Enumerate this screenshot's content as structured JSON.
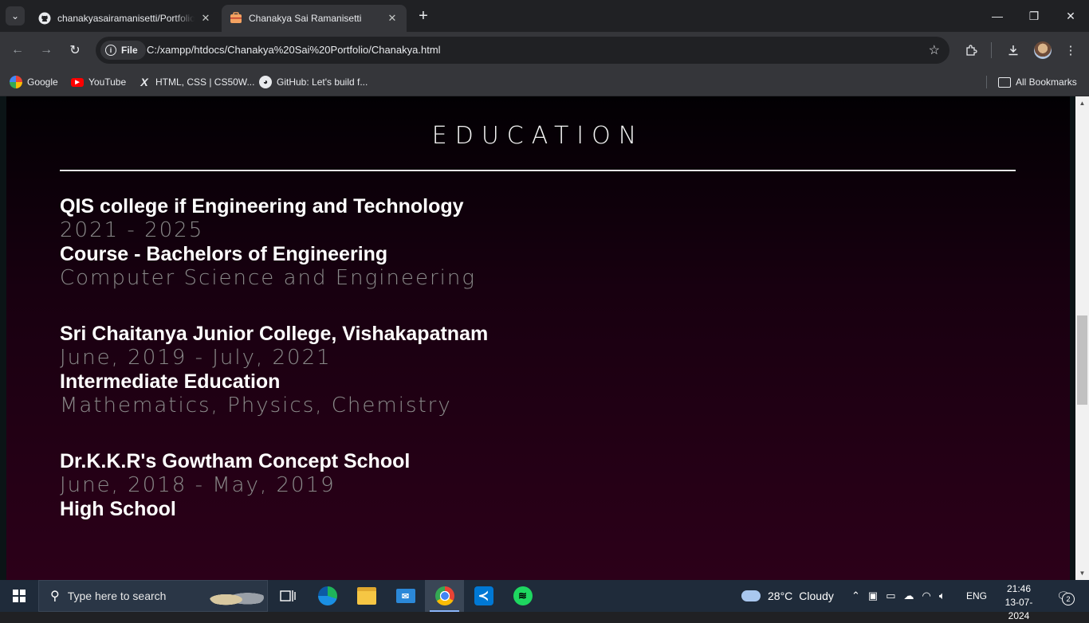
{
  "browser": {
    "tabs": [
      {
        "title": "chanakyasairamanisetti/Portfolio",
        "favicon": "github-icon",
        "active": false
      },
      {
        "title": "Chanakya Sai Ramanisetti",
        "favicon": "portfolio-favicon",
        "active": true
      }
    ],
    "omnibox": {
      "scheme_chip": "File",
      "url": "C:/xampp/htdocs/Chanakya%20Sai%20Portfolio/Chanakya.html"
    },
    "bookmarks": [
      {
        "label": "Google",
        "icon": "google-icon"
      },
      {
        "label": "YouTube",
        "icon": "youtube-icon"
      },
      {
        "label": "HTML, CSS | CS50W...",
        "icon": "x-icon"
      },
      {
        "label": "GitHub: Let's build f...",
        "icon": "github-icon"
      }
    ],
    "all_bookmarks": "All Bookmarks"
  },
  "page": {
    "heading": "EDUCATION",
    "entries": [
      {
        "institution": "QIS college if Engineering and Technology",
        "period": "2021 - 2025",
        "course": "Course - Bachelors of Engineering",
        "detail": "Computer Science and Engineering"
      },
      {
        "institution": "Sri Chaitanya Junior College, Vishakapatnam",
        "period": "June, 2019 - July, 2021",
        "course": "Intermediate Education",
        "detail": "Mathematics, Physics, Chemistry"
      },
      {
        "institution": "Dr.K.K.R's Gowtham Concept School",
        "period": "June, 2018 - May, 2019",
        "course": "High School",
        "detail": ""
      }
    ]
  },
  "taskbar": {
    "search_placeholder": "Type here to search",
    "apps": [
      "task-view-icon",
      "edge-icon",
      "file-explorer-icon",
      "mail-icon",
      "chrome-icon",
      "vscode-icon",
      "spotify-icon"
    ],
    "weather": {
      "temp": "28°C",
      "condition": "Cloudy"
    },
    "language": "ENG",
    "time": "21:46",
    "date": "13-07-2024",
    "notification_count": "2"
  },
  "colors": {
    "page_bg_top": "#020003",
    "page_bg_bottom": "#2c0019",
    "heading": "#f5f5f5",
    "muted_text": "#8a8a8a",
    "chrome_dark": "#202124",
    "chrome_toolbar": "#35363a"
  }
}
